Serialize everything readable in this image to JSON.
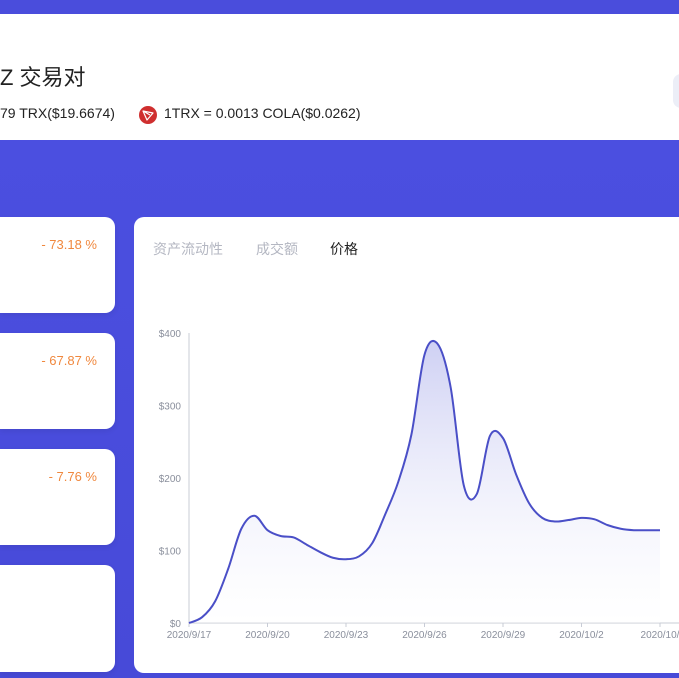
{
  "header": {
    "title": "Z 交易对",
    "price_a": "79 TRX($19.6674)",
    "price_b": "1TRX = 0.0013 COLA($0.0262)",
    "trx_icon": "tron-icon"
  },
  "stats": [
    {
      "change": "- 73.18 %"
    },
    {
      "change": "- 67.87 %"
    },
    {
      "change": "- 7.76 %"
    },
    {
      "change": ""
    }
  ],
  "tabs": [
    {
      "label": "资产流动性"
    },
    {
      "label": "成交额"
    },
    {
      "label": "价格"
    }
  ],
  "colors": {
    "accent": "#4a4ddc",
    "line": "#4a4fc7",
    "negative": "#f0883e"
  },
  "chart_data": {
    "type": "area",
    "x_ticks": [
      "2020/9/17",
      "2020/9/20",
      "2020/9/23",
      "2020/9/26",
      "2020/9/29",
      "2020/10/2",
      "2020/10/"
    ],
    "y_ticks": [
      "$0",
      "$100",
      "$200",
      "$300",
      "$400"
    ],
    "ylim": [
      0,
      400
    ],
    "x": [
      17,
      17.5,
      18,
      18.5,
      19,
      19.5,
      20,
      20.5,
      21,
      21.5,
      22,
      22.5,
      23,
      23.5,
      24,
      24.5,
      25,
      25.5,
      26,
      26.5,
      27,
      27.5,
      28,
      28.5,
      29,
      29.5,
      30,
      30.5,
      31,
      31.5,
      32,
      32.5,
      33,
      33.5,
      34,
      34.5,
      35
    ],
    "values": [
      0,
      8,
      30,
      75,
      130,
      148,
      128,
      120,
      118,
      108,
      98,
      90,
      88,
      92,
      110,
      150,
      195,
      260,
      370,
      385,
      325,
      190,
      178,
      258,
      255,
      205,
      165,
      145,
      140,
      142,
      145,
      143,
      135,
      130,
      128,
      128,
      128
    ],
    "grid": false,
    "legend": ""
  }
}
